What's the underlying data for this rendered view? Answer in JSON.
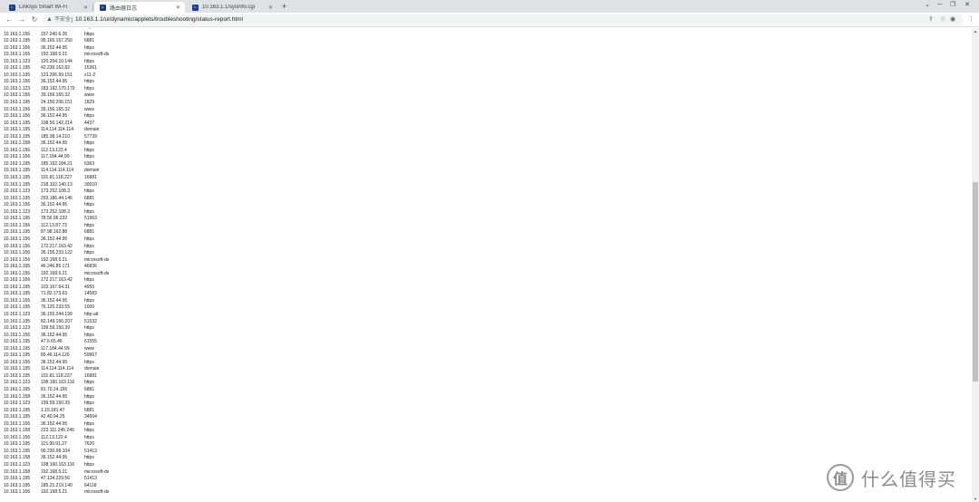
{
  "browser": {
    "tabs": [
      {
        "label": "Linksys Smart Wi-Fi",
        "active": false
      },
      {
        "label": "路由器日志",
        "active": true
      },
      {
        "label": "10.163.1.1/sysinfo.cgi",
        "active": false
      }
    ],
    "new_tab": "+",
    "window_controls": {
      "minimize": "─",
      "restore": "❐",
      "close": "✕",
      "menu": "⌄"
    },
    "nav": {
      "back": "←",
      "forward": "→",
      "reload": "↻"
    },
    "address": {
      "security_icon": "warning-icon",
      "security_label": "不安全",
      "url": "10.163.1.1/ui/dynamic/applets/troubleshooting/status-report.html"
    }
  },
  "log_rows": [
    [
      "10.163.1.195",
      "36.152.44.95",
      "https"
    ],
    [
      "10.163.1.156",
      "157.240.6.35",
      "https"
    ],
    [
      "10.163.1.195",
      "95.165.157.250",
      "6881"
    ],
    [
      "10.163.1.156",
      "36.152.44.95",
      "https"
    ],
    [
      "10.163.1.156",
      "192.168.5.21",
      "microsoft-ds"
    ],
    [
      "10.163.1.123",
      "120.204.10.144",
      "https"
    ],
    [
      "10.163.1.195",
      "42.230.162.82",
      "15361"
    ],
    [
      "10.163.1.195",
      "123.206.99.151",
      "x11-2"
    ],
    [
      "10.163.1.156",
      "36.152.44.95",
      "https"
    ],
    [
      "10.163.1.123",
      "183.192.170.170",
      "https"
    ],
    [
      "10.163.1.156",
      "39.156.165.32",
      "www"
    ],
    [
      "10.163.1.195",
      "24.150.206.151",
      "1829"
    ],
    [
      "10.163.1.156",
      "39.156.165.32",
      "www"
    ],
    [
      "10.163.1.156",
      "36.152.44.95",
      "https"
    ],
    [
      "10.163.1.195",
      "108.50.142.214",
      "4437"
    ],
    [
      "10.163.1.195",
      "114.114.114.114",
      "domain"
    ],
    [
      "10.163.1.195",
      "185.38.14.210",
      "57739"
    ],
    [
      "10.163.1.158",
      "36.152.44.95",
      "https"
    ],
    [
      "10.163.1.156",
      "112.13.122.4",
      "https"
    ],
    [
      "10.163.1.156",
      "117.184.44.99",
      "https"
    ],
    [
      "10.163.1.195",
      "185.162.184.21",
      "6363"
    ],
    [
      "10.163.1.195",
      "114.114.114.114",
      "domain"
    ],
    [
      "10.163.1.195",
      "101.81.118.227",
      "16881"
    ],
    [
      "10.163.1.195",
      "218.102.140.13",
      "30010"
    ],
    [
      "10.163.1.123",
      "173.252.108.3",
      "https"
    ],
    [
      "10.163.1.195",
      "203.186.44.146",
      "6881"
    ],
    [
      "10.163.1.156",
      "36.152.44.95",
      "https"
    ],
    [
      "10.163.1.123",
      "173.252.108.3",
      "https"
    ],
    [
      "10.163.1.195",
      "78.56.96.232",
      "51963"
    ],
    [
      "10.163.1.156",
      "112.13.87.73",
      "https"
    ],
    [
      "10.163.1.195",
      "87.98.162.88",
      "6881"
    ],
    [
      "10.163.1.156",
      "36.152.44.95",
      "https"
    ],
    [
      "10.163.1.156",
      "172.217.163.42",
      "https"
    ],
    [
      "10.163.1.156",
      "36.155.233.122",
      "https"
    ],
    [
      "10.163.1.156",
      "192.168.5.21",
      "microsoft-ds"
    ],
    [
      "10.163.1.195",
      "46.246.85.171",
      "46836"
    ],
    [
      "10.163.1.156",
      "192.168.5.21",
      "microsoft-ds"
    ],
    [
      "10.163.1.156",
      "172.217.163.42",
      "https"
    ],
    [
      "10.163.1.195",
      "103.167.64.31",
      "4955"
    ],
    [
      "10.163.1.195",
      "71.82.173.63",
      "14583"
    ],
    [
      "10.163.1.156",
      "36.152.44.95",
      "https"
    ],
    [
      "10.163.1.195",
      "76.120.233.55",
      "1000"
    ],
    [
      "10.163.1.123",
      "36.155.244.199",
      "http-alt"
    ],
    [
      "10.163.1.195",
      "83.149.166.207",
      "51532"
    ],
    [
      "10.163.1.123",
      "199.59.150.39",
      "https"
    ],
    [
      "10.163.1.156",
      "36.152.44.95",
      "https"
    ],
    [
      "10.163.1.195",
      "47.6.65.46",
      "61555"
    ],
    [
      "10.163.1.195",
      "117.184.44.99",
      "www"
    ],
    [
      "10.163.1.195",
      "89.46.114.126",
      "59967"
    ],
    [
      "10.163.1.156",
      "36.152.44.95",
      "https"
    ],
    [
      "10.163.1.195",
      "114.114.114.114",
      "domain"
    ],
    [
      "10.163.1.195",
      "101.81.118.227",
      "16881"
    ],
    [
      "10.163.1.123",
      "108.160.163.116",
      "https"
    ],
    [
      "10.163.1.195",
      "81.70.14.155",
      "6881"
    ],
    [
      "10.163.1.158",
      "36.152.44.95",
      "https"
    ],
    [
      "10.163.1.123",
      "199.59.150.39",
      "https"
    ],
    [
      "10.163.1.195",
      "1.15.181.47",
      "6881"
    ],
    [
      "10.163.1.195",
      "42.40.94.25",
      "34564"
    ],
    [
      "10.163.1.156",
      "36.152.44.95",
      "https"
    ],
    [
      "10.163.1.158",
      "223.111.245.249",
      "https"
    ],
    [
      "10.163.1.156",
      "112.13.122.4",
      "https"
    ],
    [
      "10.163.1.195",
      "115.90.91.27",
      "7620"
    ],
    [
      "10.163.1.195",
      "90.230.98.104",
      "51413"
    ],
    [
      "10.163.1.158",
      "36.152.44.95",
      "https"
    ],
    [
      "10.163.1.123",
      "108.160.163.116",
      "https"
    ],
    [
      "10.163.1.158",
      "192.168.5.21",
      "microsoft-ds"
    ],
    [
      "10.163.1.195",
      "47.134.229.56",
      "51413"
    ],
    [
      "10.163.1.195",
      "185.21.219.140",
      "64118"
    ],
    [
      "10.163.1.156",
      "192.168.5.21",
      "microsoft-ds"
    ]
  ],
  "watermark": {
    "logo": "值",
    "text": "什么值得买"
  }
}
